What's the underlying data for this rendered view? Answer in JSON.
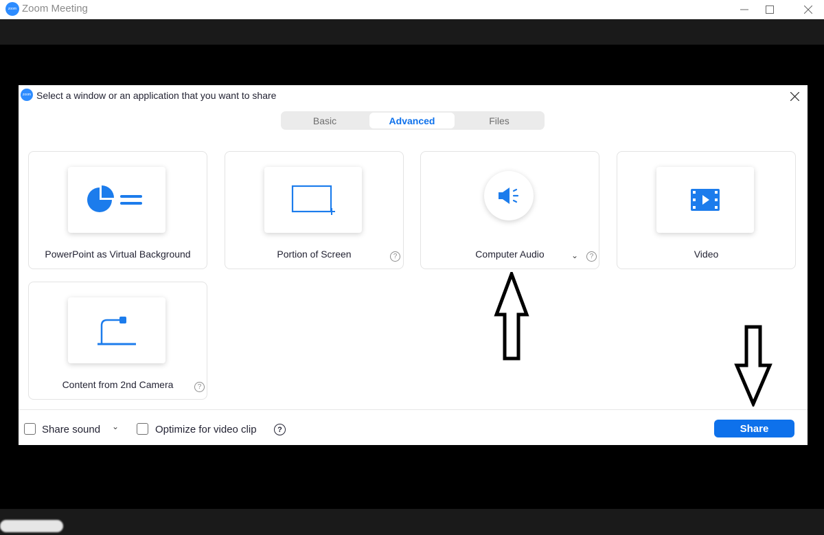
{
  "window": {
    "title": "Zoom Meeting",
    "logo_text": "zoom"
  },
  "dialog": {
    "title": "Select a window or an application that you want to share",
    "tabs": [
      {
        "label": "Basic",
        "active": false
      },
      {
        "label": "Advanced",
        "active": true
      },
      {
        "label": "Files",
        "active": false
      }
    ],
    "options": [
      {
        "label": "PowerPoint as Virtual Background",
        "icon": "pie-chart-icon"
      },
      {
        "label": "Portion of Screen",
        "icon": "screen-portion-icon"
      },
      {
        "label": "Computer Audio",
        "icon": "speaker-icon"
      },
      {
        "label": "Video",
        "icon": "film-icon"
      },
      {
        "label": "Content from 2nd Camera",
        "icon": "document-camera-icon"
      }
    ],
    "footer": {
      "share_sound_label": "Share sound",
      "optimize_label": "Optimize for video clip",
      "share_button_label": "Share"
    }
  },
  "colors": {
    "accent": "#0E71EB",
    "zoom_blue": "#2D8CFF",
    "icon_blue": "#1C7CEC"
  }
}
